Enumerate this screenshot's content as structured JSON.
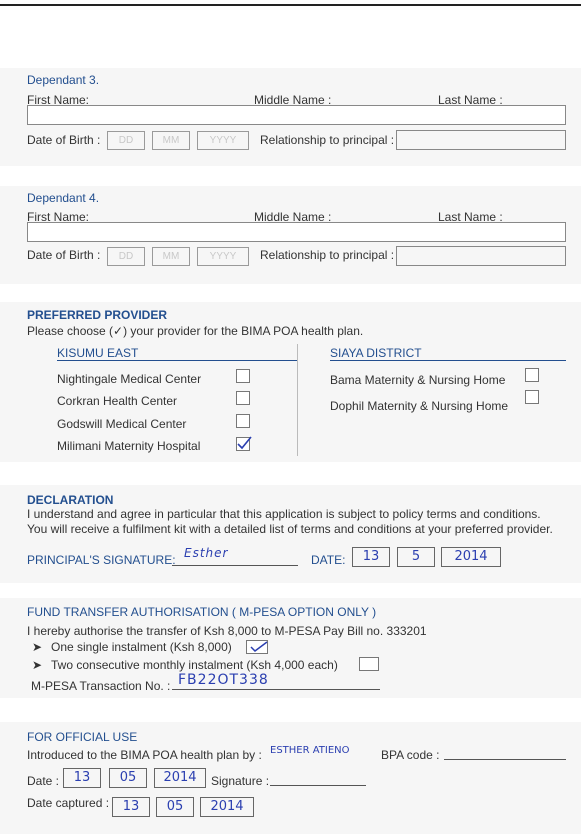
{
  "dependant3": {
    "title": "Dependant 3.",
    "first_name": "First Name:",
    "middle_name": "Middle Name :",
    "last_name": "Last Name :",
    "dob": "Date of Birth :",
    "dd": "DD",
    "mm": "MM",
    "yyyy": "YYYY",
    "relationship": "Relationship to principal :"
  },
  "dependant4": {
    "title": "Dependant 4.",
    "first_name": "First Name:",
    "middle_name": "Middle Name :",
    "last_name": "Last Name :",
    "dob": "Date of Birth :",
    "dd": "DD",
    "mm": "MM",
    "yyyy": "YYYY",
    "relationship": "Relationship to principal :"
  },
  "provider": {
    "title": "PREFERRED PROVIDER",
    "instruction": "Please choose (✓) your provider for the BIMA POA health plan.",
    "col1_title": "KISUMU EAST",
    "col2_title": "SIAYA DISTRICT",
    "col1_items": [
      {
        "label": "Nightingale Medical Center",
        "checked": false
      },
      {
        "label": "Corkran Health Center",
        "checked": false
      },
      {
        "label": "Godswill Medical Center",
        "checked": false
      },
      {
        "label": "Milimani Maternity Hospital",
        "checked": true
      }
    ],
    "col2_items": [
      {
        "label": "Bama Maternity & Nursing Home",
        "checked": false
      },
      {
        "label": "Dophil Maternity & Nursing Home",
        "checked": false
      }
    ]
  },
  "declaration": {
    "title": "DECLARATION",
    "line1": "I understand and agree in particular that this application is subject to policy terms and conditions.",
    "line2": "You will receive a fulfilment kit with a detailed list of terms and conditions at your preferred provider.",
    "signature_label": "PRINCIPAL'S SIGNATURE:",
    "signature_value": "Esther",
    "date_label": "DATE:",
    "date_dd": "13",
    "date_mm": "5",
    "date_yyyy": "2014"
  },
  "fund": {
    "title": "FUND TRANSFER AUTHORISATION ( M-PESA OPTION ONLY )",
    "line": "I hereby authorise the transfer of Ksh 8,000 to M-PESA Pay Bill no. 333201",
    "opt1": "One single instalment (Ksh 8,000)",
    "opt1_checked": true,
    "opt2": "Two consecutive monthly instalment (Ksh 4,000 each)",
    "opt2_checked": false,
    "txn_label": "M-PESA Transaction No. :",
    "txn_value": "FB22OT338"
  },
  "official": {
    "title": "FOR OFFICIAL USE",
    "introduced_label": "Introduced to the BIMA POA health plan by :",
    "introduced_value": "ESTHER ATIENO",
    "bpa_label": "BPA code :",
    "date_label": "Date :",
    "date_dd": "13",
    "date_mm": "05",
    "date_yyyy": "2014",
    "signature_label": "Signature :",
    "captured_label": "Date captured :",
    "cap_dd": "13",
    "cap_mm": "05",
    "cap_yyyy": "2014"
  }
}
